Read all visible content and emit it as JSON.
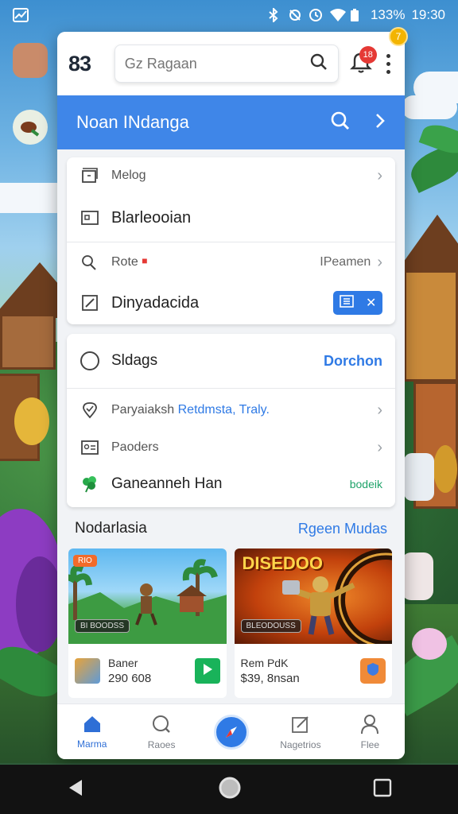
{
  "status_bar": {
    "battery_text": "133%",
    "time": "19:30"
  },
  "colors": {
    "accent_blue": "#3f86e8",
    "link_blue": "#2f7ae5",
    "green": "#1fa36a",
    "badge_red": "#e53935"
  },
  "topbar": {
    "logo_text": "83",
    "search_placeholder": "Gz Ragaan",
    "notification_count": "18",
    "corner_badge": "7"
  },
  "header": {
    "title": "Noan INdanga"
  },
  "section1": {
    "rows": [
      {
        "label": "Melog",
        "icon": "frame-icon"
      },
      {
        "label": "Blarleooian",
        "icon": "window-icon"
      },
      {
        "label": "Rote",
        "icon": "search-person-icon",
        "right_text": "IPeamen"
      },
      {
        "label": "Dinyadacida",
        "icon": "edit-icon"
      }
    ]
  },
  "section2": {
    "rows": [
      {
        "label": "Sldags",
        "icon": "circle-icon",
        "action": "Dorchon"
      },
      {
        "label": "Paryaiaksh",
        "icon": "location-icon",
        "highlight": "Retdmsta, Traly."
      },
      {
        "label": "Paoders",
        "icon": "id-card-icon"
      },
      {
        "label": "Ganeanneh Han",
        "icon": "clover-icon",
        "action": "bodeik"
      }
    ]
  },
  "featured": {
    "title": "Nodarlasia",
    "link": "Rgeen Mudas",
    "games": [
      {
        "badge": "RIO",
        "tag": "BI BOODSS",
        "name": "Baner",
        "price": "290 608"
      },
      {
        "headline": "DISEDOO",
        "tag": "BLEODOUSS",
        "name": "Rem PdK",
        "price": "$39, 8nsan"
      }
    ]
  },
  "bottom_nav": [
    {
      "label": "Marma",
      "icon": "home-icon"
    },
    {
      "label": "Raoes",
      "icon": "search-icon"
    },
    {
      "label": "",
      "icon": "compass-icon"
    },
    {
      "label": "Nagetrios",
      "icon": "edit-square-icon"
    },
    {
      "label": "Flee",
      "icon": "person-icon"
    }
  ]
}
